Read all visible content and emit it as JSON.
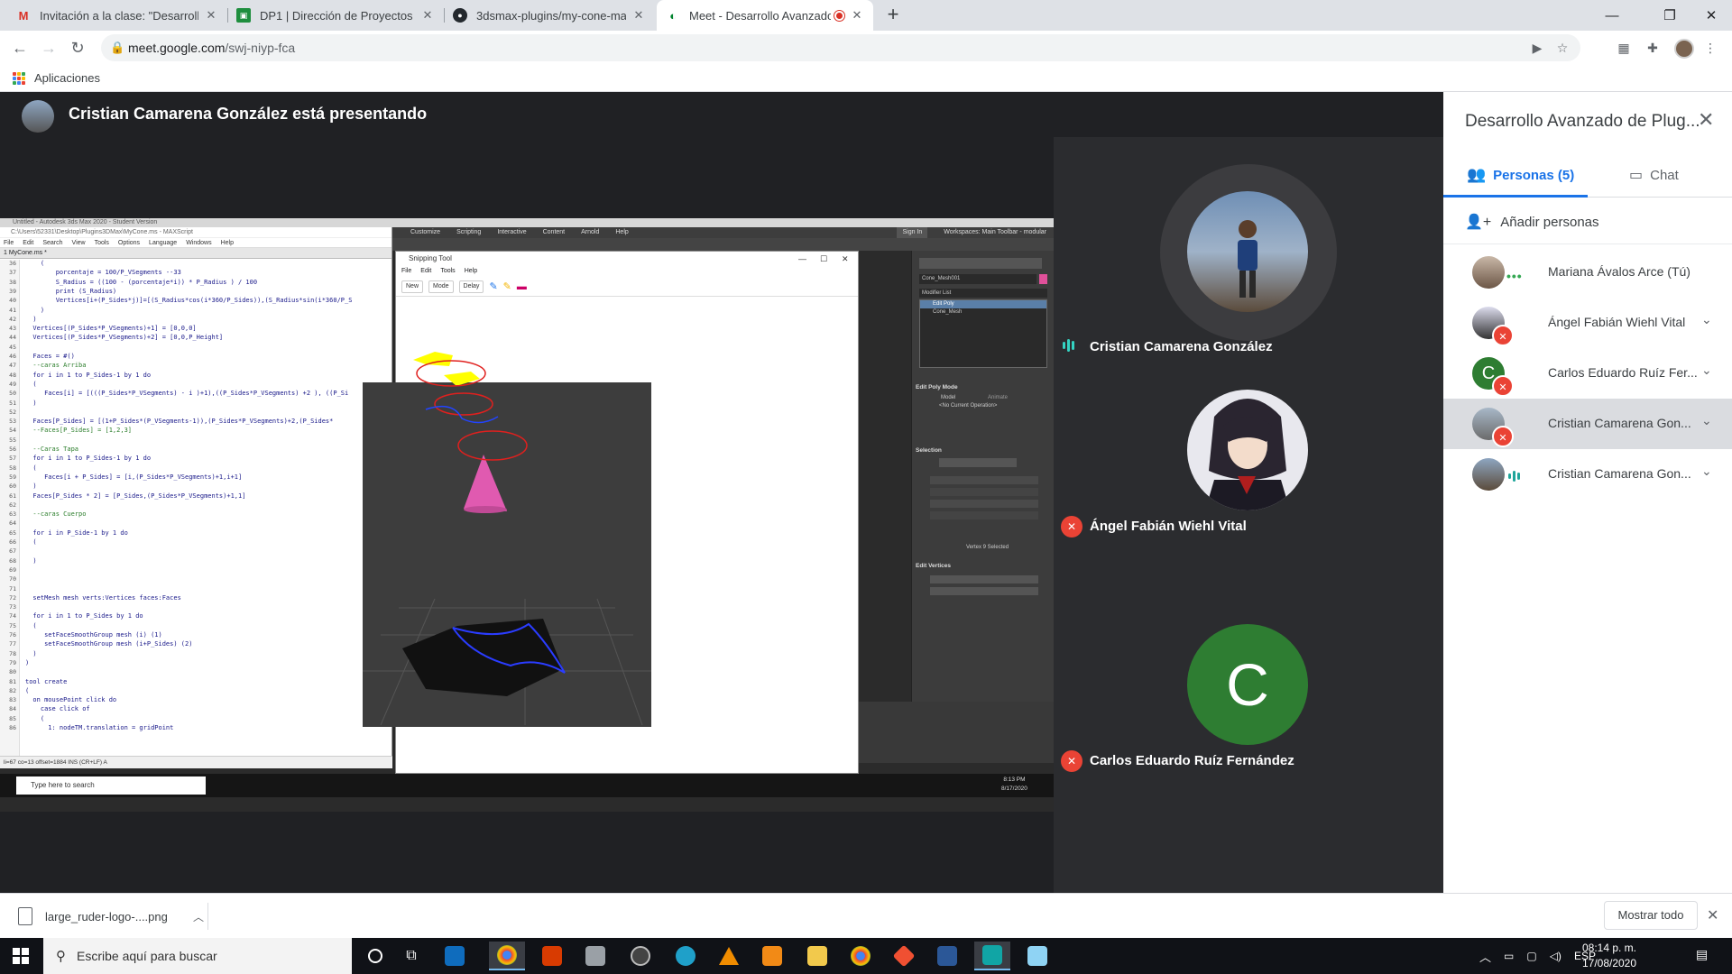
{
  "tabs": [
    {
      "label": "Invitación a la clase: \"Desarrollo A",
      "icon": "gmail-icon",
      "close": "✕"
    },
    {
      "label": "DP1 | Dirección de Proyectos 120",
      "icon": "classroom-icon",
      "close": "✕"
    },
    {
      "label": "3dsmax-plugins/my-cone-marian",
      "icon": "github-icon",
      "close": "✕"
    },
    {
      "label": "Meet - Desarrollo Avanzado d",
      "icon": "meet-icon",
      "close": "✕",
      "active": true
    }
  ],
  "new_tab": "+",
  "window_controls": {
    "minimize": "—",
    "restore": "❐",
    "close": "✕"
  },
  "address": {
    "host": "meet.google.com",
    "path": "/swj-niyp-fca"
  },
  "bookmarks": {
    "apps_label": "Aplicaciones"
  },
  "presenter": {
    "title": "Cristian Camarena González está presentando"
  },
  "shared_screen": {
    "max_title": "Untitled - Autodesk 3ds Max 2020 - Student Version",
    "max_menu": [
      "Customize",
      "Scripting",
      "Interactive",
      "Content",
      "Arnold",
      "Help"
    ],
    "sign_in": "Sign In",
    "workspaces": "Workspaces: Main Toolbar - modular",
    "editor_title": "C:\\Users\\52331\\Desktop\\Plugins3DMax\\MyCone.ms - MAXScript",
    "editor_menu": [
      "File",
      "Edit",
      "Search",
      "View",
      "Tools",
      "Options",
      "Language",
      "Windows",
      "Help"
    ],
    "editor_tab": "1 MyCone.ms *",
    "editor_status": "li=67 co=13 offset=1884 INS (CR+LF) A",
    "code": [
      {
        "n": "36",
        "t": "    ("
      },
      {
        "n": "37",
        "t": "        porcentaje = 100/P_VSegments --33"
      },
      {
        "n": "38",
        "t": "        S_Radius = ((100 - (porcentaje*i)) * P_Radius ) / 100"
      },
      {
        "n": "39",
        "t": "        print (S_Radius)"
      },
      {
        "n": "40",
        "t": "        Vertices[i+(P_Sides*j)]=[(S_Radius*cos(i*360/P_Sides)),(S_Radius*sin(i*360/P_S"
      },
      {
        "n": "41",
        "t": "    )"
      },
      {
        "n": "42",
        "t": "  )"
      },
      {
        "n": "43",
        "t": "  Vertices[(P_Sides*P_VSegments)+1] = [0,0,0]"
      },
      {
        "n": "44",
        "t": "  Vertices[(P_Sides*P_VSegments)+2] = [0,0,P_Height]"
      },
      {
        "n": "45",
        "t": ""
      },
      {
        "n": "46",
        "t": "  Faces = #()"
      },
      {
        "n": "47",
        "t": "  --caras Arriba",
        "c": true
      },
      {
        "n": "48",
        "t": "  for i in 1 to P_Sides-1 by 1 do"
      },
      {
        "n": "49",
        "t": "  ("
      },
      {
        "n": "50",
        "t": "     Faces[i] = [(((P_Sides*P_VSegments) - i )+1),((P_Sides*P_VSegments) +2 ), ((P_Si"
      },
      {
        "n": "51",
        "t": "  )"
      },
      {
        "n": "52",
        "t": ""
      },
      {
        "n": "53",
        "t": "  Faces[P_Sides] = [(1+P_Sides*(P_VSegments-1)),(P_Sides*P_VSegments)+2,(P_Sides*"
      },
      {
        "n": "54",
        "t": "  --Faces[P_Sides] = [1,2,3]",
        "c": true
      },
      {
        "n": "55",
        "t": ""
      },
      {
        "n": "56",
        "t": "  --Caras Tapa",
        "c": true
      },
      {
        "n": "57",
        "t": "  for i in 1 to P_Sides-1 by 1 do"
      },
      {
        "n": "58",
        "t": "  ("
      },
      {
        "n": "59",
        "t": "     Faces[i + P_Sides] = [i,(P_Sides*P_VSegments)+1,i+1]"
      },
      {
        "n": "60",
        "t": "  )"
      },
      {
        "n": "61",
        "t": "  Faces[P_Sides * 2] = [P_Sides,(P_Sides*P_VSegments)+1,1]"
      },
      {
        "n": "62",
        "t": ""
      },
      {
        "n": "63",
        "t": "  --caras Cuerpo",
        "c": true
      },
      {
        "n": "64",
        "t": ""
      },
      {
        "n": "65",
        "t": "  for i in P_Side-1 by 1 do"
      },
      {
        "n": "66",
        "t": "  ("
      },
      {
        "n": "67",
        "t": ""
      },
      {
        "n": "68",
        "t": "  )"
      },
      {
        "n": "69",
        "t": ""
      },
      {
        "n": "70",
        "t": ""
      },
      {
        "n": "71",
        "t": ""
      },
      {
        "n": "72",
        "t": "  setMesh mesh verts:Vertices faces:Faces"
      },
      {
        "n": "73",
        "t": ""
      },
      {
        "n": "74",
        "t": "  for i in 1 to P_Sides by 1 do"
      },
      {
        "n": "75",
        "t": "  ("
      },
      {
        "n": "76",
        "t": "     setFaceSmoothGroup mesh (i) (1)"
      },
      {
        "n": "77",
        "t": "     setFaceSmoothGroup mesh (i+P_Sides) (2)"
      },
      {
        "n": "78",
        "t": "  )"
      },
      {
        "n": "79",
        "t": ")"
      },
      {
        "n": "80",
        "t": ""
      },
      {
        "n": "81",
        "t": "tool create"
      },
      {
        "n": "82",
        "t": "("
      },
      {
        "n": "83",
        "t": "  on mousePoint click do"
      },
      {
        "n": "84",
        "t": "    case click of"
      },
      {
        "n": "85",
        "t": "    ("
      },
      {
        "n": "86",
        "t": "      1: nodeTM.translation = gridPoint"
      }
    ],
    "snip_title": "Snipping Tool",
    "snip_menu": [
      "File",
      "Edit",
      "Tools",
      "Help"
    ],
    "snip_tools": {
      "new": "New",
      "mode": "Mode",
      "delay": "Delay"
    },
    "modifier": {
      "object_name": "Cone_Mesh001",
      "list_label": "Modifier List",
      "stack": [
        "Edit Poly",
        "Cone_Mesh"
      ],
      "sections": [
        "Edit Poly Mode",
        "Selection",
        "Edit Vertices"
      ],
      "model": "Model",
      "animate": "Animate",
      "no_op": "<No Current Operation>",
      "vertex_selected": "Vertex 9 Selected"
    },
    "inner_search": "Type here to search",
    "inner_clock": {
      "time": "8:13 PM",
      "date": "8/17/2020"
    }
  },
  "participants_tiles": [
    {
      "name": "Cristian Camarena González",
      "state": "speaking"
    },
    {
      "name": "Ángel Fabián Wiehl Vital",
      "state": "muted"
    },
    {
      "name": "Carlos Eduardo Ruíz Fernández",
      "state": "muted",
      "letter": "C"
    }
  ],
  "panel": {
    "title": "Desarrollo Avanzado de Plug...",
    "tab_people": "Personas (5)",
    "tab_chat": "Chat",
    "add_people": "Añadir personas",
    "people": [
      {
        "name": "Mariana Ávalos Arce (Tú)",
        "state": "dots"
      },
      {
        "name": "Ángel Fabián Wiehl Vital",
        "state": "muted"
      },
      {
        "name": "Carlos Eduardo Ruíz Fer...",
        "state": "muted",
        "letter": "C"
      },
      {
        "name": "Cristian Camarena Gon...",
        "state": "muted-highlight"
      },
      {
        "name": "Cristian Camarena Gon...",
        "state": "speaking"
      }
    ]
  },
  "downloads": {
    "file": "large_ruder-logo-....png",
    "show_all": "Mostrar todo"
  },
  "taskbar": {
    "search_placeholder": "Escribe aquí para buscar",
    "language": "ESP",
    "time": "08:14 p. m.",
    "date": "17/08/2020"
  },
  "colors": {
    "accent": "#1a73e8",
    "muted": "#ea4335",
    "speaking": "#34d3c2",
    "avatar_green": "#2e7d32"
  }
}
